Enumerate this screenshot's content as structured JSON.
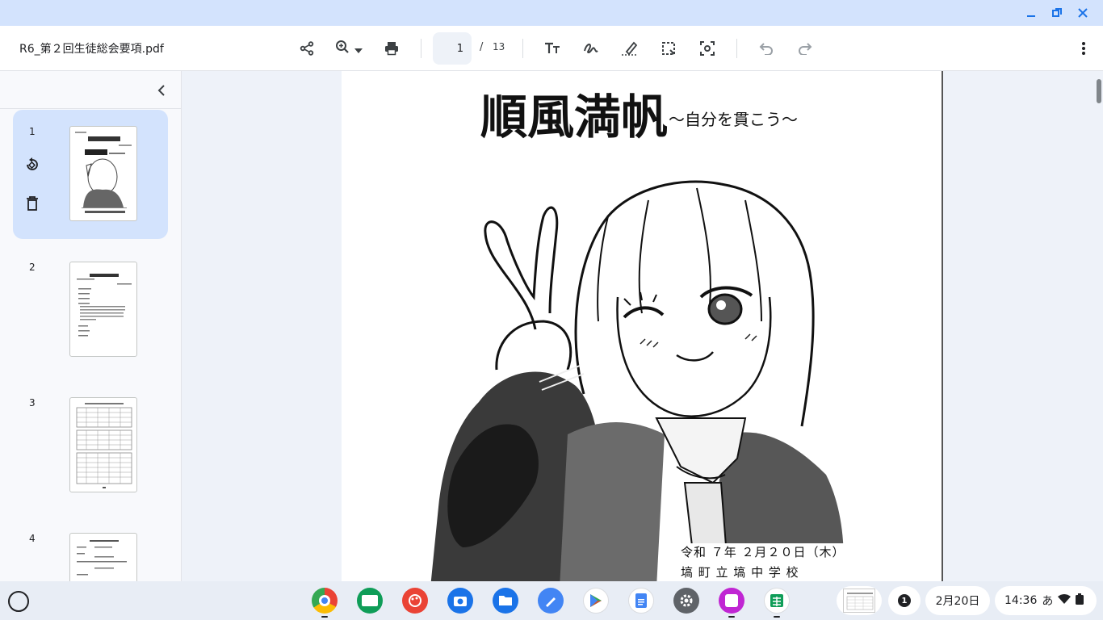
{
  "window": {
    "controls": [
      "minimize",
      "restore",
      "close"
    ]
  },
  "toolbar": {
    "file_name": "R6_第２回生徒総会要項.pdf",
    "current_page": "1",
    "page_separator": "/",
    "total_pages": "13",
    "icons": [
      "share-icon",
      "zoom-icon",
      "print-icon",
      "text-icon",
      "draw-icon",
      "highlight-icon",
      "select-icon",
      "screenshot-icon",
      "undo-icon",
      "redo-icon",
      "more-icon"
    ]
  },
  "sidebar": {
    "thumbnails": [
      {
        "number": "1",
        "selected": true
      },
      {
        "number": "2",
        "selected": false
      },
      {
        "number": "3",
        "selected": false
      },
      {
        "number": "4",
        "selected": false
      }
    ]
  },
  "document": {
    "title": "順風満帆",
    "subtitle": "～自分を貫こう～",
    "date_line": "令和 ７年 ２月２０日（木）",
    "school_line": "塙 町 立 塙 中 学 校"
  },
  "shelf": {
    "apps": [
      "chrome",
      "classroom",
      "canvas",
      "camera",
      "files",
      "cursive",
      "play-store",
      "docs",
      "settings",
      "screencast",
      "sheets"
    ],
    "notification_count": "1",
    "date": "2月20日",
    "time": "14:36",
    "ime": "あ"
  },
  "colors": {
    "titlebar": "#d3e3fd",
    "accent": "#1a73e8",
    "selected_thumb": "#d3e3fd",
    "viewer_bg": "#eef2f9"
  }
}
